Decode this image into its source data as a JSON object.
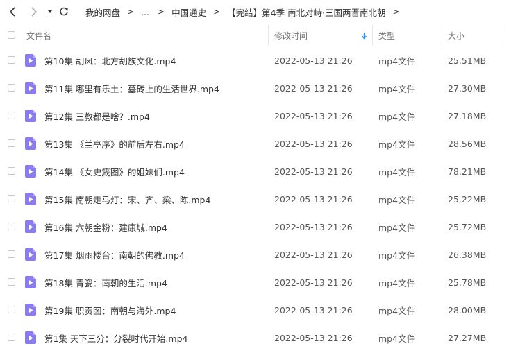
{
  "nav": {
    "back_icon": "chevron-left-icon",
    "forward_icon": "chevron-right-icon",
    "dropdown_icon": "caret-down-icon",
    "refresh_icon": "refresh-icon"
  },
  "breadcrumb": {
    "items": [
      "我的网盘",
      "...",
      "中国通史",
      "【完结】第4季 南北对峙·三国两晋南北朝"
    ],
    "separator": ">"
  },
  "columns": {
    "name": "文件名",
    "modified": "修改时间",
    "type": "类型",
    "size": "大小",
    "sort_icon": "sort-down-arrow-icon"
  },
  "colors": {
    "accent": "#3a8ee6",
    "file_icon": "#8a7cf0"
  },
  "files": [
    {
      "name": "第10集 胡风：北方胡族文化.mp4",
      "modified": "2022-05-13 21:26",
      "type": "mp4文件",
      "size": "25.51MB"
    },
    {
      "name": "第11集 哪里有乐土：墓砖上的生活世界.mp4",
      "modified": "2022-05-13 21:26",
      "type": "mp4文件",
      "size": "27.30MB"
    },
    {
      "name": "第12集 三教都是啥？.mp4",
      "modified": "2022-05-13 21:26",
      "type": "mp4文件",
      "size": "27.18MB"
    },
    {
      "name": "第13集 《兰亭序》的前后左右.mp4",
      "modified": "2022-05-13 21:26",
      "type": "mp4文件",
      "size": "28.56MB"
    },
    {
      "name": "第14集 《女史箴图》的姐妹们.mp4",
      "modified": "2022-05-13 21:26",
      "type": "mp4文件",
      "size": "78.21MB"
    },
    {
      "name": "第15集 南朝走马灯：宋、齐、梁、陈.mp4",
      "modified": "2022-05-13 21:26",
      "type": "mp4文件",
      "size": "25.22MB"
    },
    {
      "name": "第16集 六朝金粉：建康城.mp4",
      "modified": "2022-05-13 21:26",
      "type": "mp4文件",
      "size": "25.72MB"
    },
    {
      "name": "第17集 烟雨楼台：南朝的佛教.mp4",
      "modified": "2022-05-13 21:26",
      "type": "mp4文件",
      "size": "26.38MB"
    },
    {
      "name": "第18集 青瓷：南朝的生活.mp4",
      "modified": "2022-05-13 21:26",
      "type": "mp4文件",
      "size": "25.78MB"
    },
    {
      "name": "第19集 职贡图：南朝与海外.mp4",
      "modified": "2022-05-13 21:26",
      "type": "mp4文件",
      "size": "28.00MB"
    },
    {
      "name": "第1集 天下三分：分裂时代开始.mp4",
      "modified": "2022-05-13 21:26",
      "type": "mp4文件",
      "size": "27.27MB"
    }
  ]
}
